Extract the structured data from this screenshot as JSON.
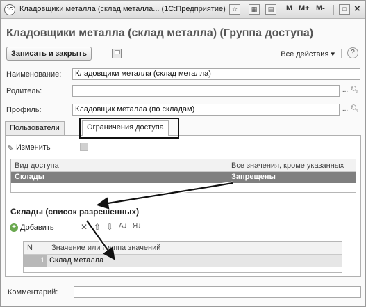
{
  "window": {
    "logo": "1С",
    "title": "Кладовщики металла (склад металла... (1С:Предприятие)",
    "buttons": {
      "m": "M",
      "m_plus": "M+",
      "m_minus": "M-"
    }
  },
  "form": {
    "title": "Кладовщики металла (склад металла) (Группа доступа)",
    "save_close_label": "Записать и закрыть",
    "all_actions_label": "Все действия ▾",
    "help_label": "?"
  },
  "fields": {
    "name": {
      "label": "Наименование:",
      "value": "Кладовщики металла (склад металла)"
    },
    "parent": {
      "label": "Родитель:",
      "value": ""
    },
    "profile": {
      "label": "Профиль:",
      "value": "Кладовщик металла (по складам)"
    }
  },
  "tabs": [
    {
      "label": "Пользователи",
      "active": false
    },
    {
      "label": "Ограничения доступа",
      "active": true
    }
  ],
  "access_panel": {
    "edit_label": "Изменить",
    "grid": {
      "columns": [
        "Вид доступа",
        "Все значения, кроме указанных"
      ],
      "rows": [
        {
          "kind": "Склады",
          "value": "Запрещены",
          "selected": true
        }
      ]
    },
    "section_title": "Склады (список разрешенных)",
    "add_label": "Добавить",
    "values_grid": {
      "columns": [
        "N",
        "Значение или группа значений"
      ],
      "rows": [
        {
          "n": "1",
          "value": "Склад металла"
        }
      ]
    }
  },
  "comment": {
    "label": "Комментарий:",
    "value": ""
  },
  "colors": {
    "selected_row": "#7f7f7f",
    "highlight_frame": "#111111",
    "arrow": "#111111"
  }
}
